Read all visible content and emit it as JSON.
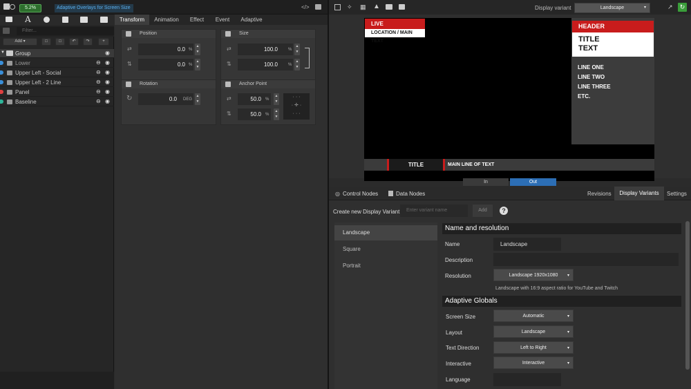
{
  "toolbar": {
    "zoom": "5.2%",
    "doc_title": "Adaptive Overlays for Screen Size"
  },
  "left_panel": {
    "filter_placeholder": "Filter...",
    "add_label": "Add",
    "layers": [
      {
        "name": "Group",
        "color": "#7a7a7a"
      },
      {
        "name": "Lower",
        "color": "#3a8fd9"
      },
      {
        "name": "Upper Left - Social",
        "color": "#3a8fd9"
      },
      {
        "name": "Upper Left - 2 Line",
        "color": "#3a8fd9"
      },
      {
        "name": "Panel",
        "color": "#e04040"
      },
      {
        "name": "Baseline",
        "color": "#2fb59a"
      }
    ]
  },
  "props": {
    "tabs": [
      "Transform",
      "Animation",
      "Effect",
      "Event",
      "Adaptive"
    ],
    "position": {
      "title": "Position",
      "x": "0.0",
      "y": "0.0",
      "unit": "%"
    },
    "size": {
      "title": "Size",
      "w": "100.0",
      "h": "100.0",
      "unit": "%"
    },
    "rotation": {
      "title": "Rotation",
      "value": "0.0",
      "unit": "DEG"
    },
    "anchor": {
      "title": "Anchor Point",
      "x": "50.0",
      "y": "50.0",
      "unit": "%"
    }
  },
  "preview": {
    "display_variant_label": "Display variant",
    "display_variant_value": "Landscape",
    "live": "LIVE",
    "location": "LOCATION / MAIN TEXT",
    "header": "HEADER",
    "title_text": "TITLE\nTEXT",
    "lines": [
      "LINE ONE",
      "LINE TWO",
      "LINE THREE",
      "ETC."
    ],
    "lower_title": "TITLE",
    "lower_main": "MAIN LINE OF TEXT",
    "in_label": "In",
    "out_label": "Out"
  },
  "bottom": {
    "tabs_left": [
      "Control Nodes",
      "Data Nodes"
    ],
    "tabs_right": [
      "Revisions",
      "Display Variants",
      "Settings"
    ],
    "create_label": "Create new Display Variant",
    "variant_placeholder": "Enter variant name",
    "add_label": "Add",
    "help": "?",
    "variants": [
      "Landscape",
      "Square",
      "Portrait"
    ],
    "name_res_head": "Name and resolution",
    "name_label": "Name",
    "name_value": "Landscape",
    "desc_label": "Description",
    "res_label": "Resolution",
    "res_value": "Landscape 1920x1080",
    "res_note": "Landscape with 16:9 aspect ratio for YouTube and Twitch",
    "globals_head": "Adaptive Globals",
    "screen_size_label": "Screen Size",
    "screen_size_value": "Automatic",
    "layout_label": "Layout",
    "layout_value": "Landscape",
    "text_dir_label": "Text Direction",
    "text_dir_value": "Left to Right",
    "interactive_label": "Interactive",
    "interactive_value": "Interactive",
    "language_label": "Language"
  }
}
